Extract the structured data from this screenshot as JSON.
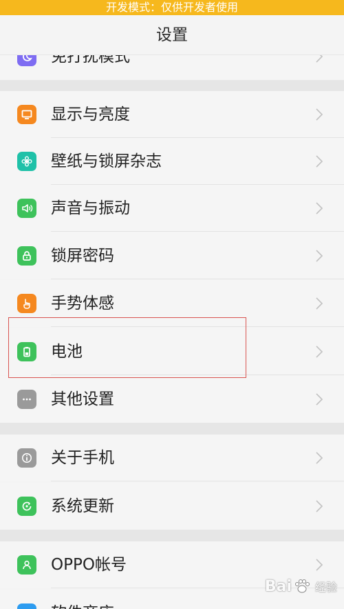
{
  "status_bar": {
    "developer_mode_text": "开发模式：仅供开发者使用"
  },
  "header": {
    "title": "设置"
  },
  "colors": {
    "dev_bar": "#f6b81d",
    "orange": "#f5881f",
    "teal": "#1fc1a8",
    "green": "#3ec25b",
    "gray": "#9a9a9a",
    "purple": "#7e6cf2",
    "blue": "#2d9cf0",
    "highlight_box": "#d9534f"
  },
  "partial_top_item": {
    "label": "免打扰模式",
    "icon": "moon-icon"
  },
  "groups": [
    {
      "items": [
        {
          "id": "display",
          "label": "显示与亮度",
          "icon": "monitor-icon"
        },
        {
          "id": "wallpaper",
          "label": "壁纸与锁屏杂志",
          "icon": "flower-icon"
        },
        {
          "id": "sound",
          "label": "声音与振动",
          "icon": "speaker-icon"
        },
        {
          "id": "lockscreen",
          "label": "锁屏密码",
          "icon": "lock-icon"
        },
        {
          "id": "gesture",
          "label": "手势体感",
          "icon": "hand-icon"
        },
        {
          "id": "battery",
          "label": "电池",
          "icon": "battery-icon"
        },
        {
          "id": "other",
          "label": "其他设置",
          "icon": "more-icon"
        }
      ]
    },
    {
      "items": [
        {
          "id": "about",
          "label": "关于手机",
          "icon": "info-icon"
        },
        {
          "id": "update",
          "label": "系统更新",
          "icon": "update-icon"
        }
      ]
    },
    {
      "items": [
        {
          "id": "account",
          "label": "OPPO帐号",
          "icon": "user-icon"
        }
      ]
    }
  ],
  "partial_bottom_item": {
    "label": "软件商店",
    "icon": "store-icon"
  },
  "watermark": {
    "text": "Bai",
    "suffix": "经验"
  }
}
